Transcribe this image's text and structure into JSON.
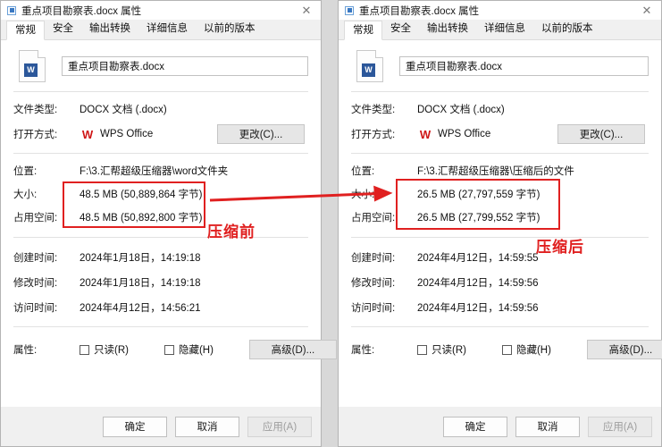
{
  "colors": {
    "annotation_red": "#e02020",
    "accent_blue": "#2a7bd4",
    "wps_red": "#cf1616"
  },
  "tabs": [
    "常规",
    "安全",
    "输出转换",
    "详细信息",
    "以前的版本"
  ],
  "labels": {
    "file_type": "文件类型:",
    "open_with": "打开方式:",
    "location": "位置:",
    "size": "大小:",
    "size_on_disk": "占用空间:",
    "created": "创建时间:",
    "modified": "修改时间:",
    "accessed": "访问时间:",
    "attributes": "属性:",
    "change_button": "更改(C)...",
    "advanced_button": "高级(D)...",
    "readonly": "只读(R)",
    "hidden": "隐藏(H)",
    "ok": "确定",
    "cancel": "取消",
    "apply": "应用(A)",
    "close": "✕",
    "word_badge": "W",
    "wps_logo": "W"
  },
  "left": {
    "title": "重点项目勘察表.docx 属性",
    "filename": "重点项目勘察表.docx",
    "file_type": "DOCX 文档 (.docx)",
    "open_with": "WPS Office",
    "location": "F:\\3.汇帮超级压缩器\\word文件夹",
    "size": "48.5 MB (50,889,864 字节)",
    "size_on_disk": "48.5 MB (50,892,800 字节)",
    "created": "2024年1月18日，14:19:18",
    "modified": "2024年1月18日，14:19:18",
    "accessed": "2024年4月12日，14:56:21"
  },
  "right": {
    "title": "重点项目勘察表.docx 属性",
    "filename": "重点项目勘察表.docx",
    "file_type": "DOCX 文档 (.docx)",
    "open_with": "WPS Office",
    "location": "F:\\3.汇帮超级压缩器\\压缩后的文件",
    "size": "26.5 MB (27,797,559 字节)",
    "size_on_disk": "26.5 MB (27,799,552 字节)",
    "created": "2024年4月12日，14:59:55",
    "modified": "2024年4月12日，14:59:56",
    "accessed": "2024年4月12日，14:59:56"
  },
  "annotations": {
    "before_label": "压缩前",
    "after_label": "压缩后"
  }
}
